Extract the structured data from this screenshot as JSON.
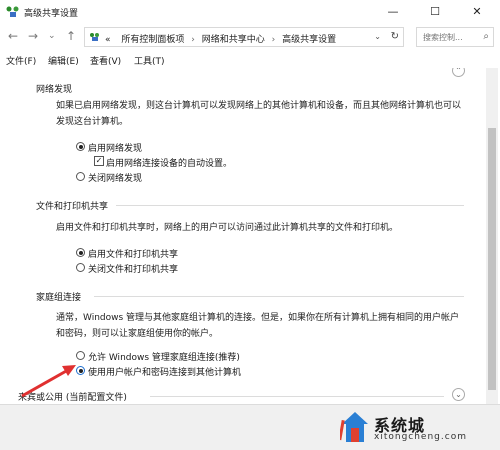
{
  "window": {
    "title": "高级共享设置",
    "minimize": "—",
    "maximize": "☐",
    "close": "✕"
  },
  "nav": {
    "back": "←",
    "forward": "→",
    "dropdown": "⌄",
    "up": "↑"
  },
  "address": {
    "overflow": "«",
    "crumbs": [
      "所有控制面板项",
      "网络和共享中心",
      "高级共享设置"
    ],
    "separator": "›",
    "dropdown": "⌄",
    "refresh": "↻"
  },
  "search": {
    "placeholder": "搜索控制...",
    "icon": "⌕"
  },
  "menu": [
    "文件(F)",
    "编辑(E)",
    "查看(V)",
    "工具(T)"
  ],
  "network_discovery": {
    "heading": "网络发现",
    "description": "如果已启用网络发现，则这台计算机可以发现网络上的其他计算机和设备，而且其他网络计算机也可以发现这台计算机。",
    "options": [
      {
        "label": "启用网络发现",
        "selected": true
      },
      {
        "label": "关闭网络发现",
        "selected": false
      }
    ],
    "auto_setup": {
      "label": "启用网络连接设备的自动设置。",
      "checked": true
    }
  },
  "file_printer": {
    "heading": "文件和打印机共享",
    "description": "启用文件和打印机共享时，网络上的用户可以访问通过此计算机共享的文件和打印机。",
    "options": [
      {
        "label": "启用文件和打印机共享",
        "selected": true
      },
      {
        "label": "关闭文件和打印机共享",
        "selected": false
      }
    ]
  },
  "homegroup": {
    "heading": "家庭组连接",
    "description": "通常，Windows 管理与其他家庭组计算机的连接。但是，如果你在所有计算机上拥有相同的用户帐户和密码，则可以让家庭组使用你的帐户。",
    "options": [
      {
        "label": "允许 Windows 管理家庭组连接(推荐)",
        "selected": false
      },
      {
        "label": "使用用户帐户和密码连接到其他计算机",
        "selected": true
      }
    ]
  },
  "next_section": {
    "heading": "来宾或公用 (当前配置文件)",
    "chevron": "⌄"
  },
  "top_chevron": "⌃",
  "watermark": {
    "name": "系统城",
    "url": "xitongcheng.com"
  },
  "colors": {
    "arrow": "#e03030",
    "selected_radio": "#222222",
    "watermark_blue": "#2a7fd4",
    "watermark_red": "#e04030"
  }
}
